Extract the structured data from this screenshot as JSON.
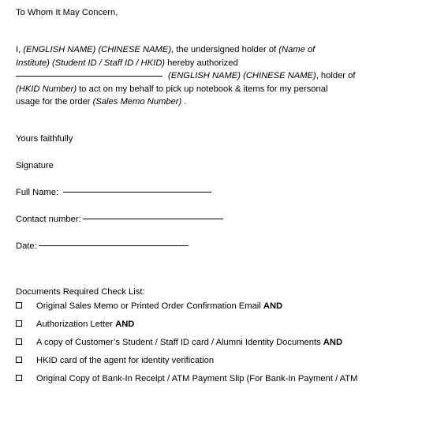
{
  "document": {
    "type": "authorization-letter",
    "salutation": "To Whom It May Concern,",
    "paragraph": {
      "line1_a": "I, ",
      "line1_it1": "(ENGLISH NAME) (CHINESE NAME)",
      "line1_b": ", the undersigned holder of ",
      "line1_it2": "(Name of",
      "line2_it": "Institute) (Student ID / Staff ID / HKID)",
      "line2_b": " hereby authorized",
      "line3_it": "(ENGLISH NAME) (CHINESE NAME)",
      "line3_b": ", holder of",
      "line4_it": "(HKID Number)",
      "line4_b": " to act on my behalf to pick up notebook & items for my personal",
      "line5_a": "usage for the order ",
      "line5_it": "(Sales Memo Number)",
      "line5_b": " ."
    },
    "closing": "Yours faithfully",
    "signature_label": "Signature",
    "fields": [
      {
        "label": "Full Name:",
        "value": ""
      },
      {
        "label": "Contact number:",
        "value": ""
      },
      {
        "label": "Date:",
        "value": ""
      }
    ],
    "checklist": {
      "heading": "Documents Required Check List:",
      "items": [
        {
          "text": "Original Sales Memo or Printed Order Confirmation Email ",
          "suffix": "AND",
          "checked": false
        },
        {
          "text": "Authorization Letter ",
          "suffix": "AND",
          "checked": false
        },
        {
          "text": "A copy of Customer’s Student / Staff ID card / Alumni Identity Documents ",
          "suffix": "AND",
          "checked": false
        },
        {
          "text": "HKID card of the agent for identity verification",
          "suffix": "",
          "checked": false
        },
        {
          "text": "Original Copy of Bank-In Receipt / ATM Payment Slip (For Bank-In Payment / ATM",
          "suffix": "",
          "checked": false
        }
      ]
    },
    "colors": {
      "text": "#000000",
      "background": "#ffffff",
      "spellcheck_underline": "#3f8f3f"
    }
  }
}
